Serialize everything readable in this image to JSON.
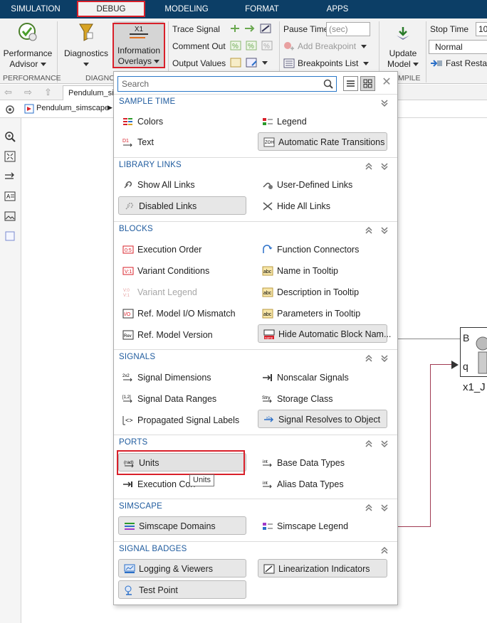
{
  "tabs": [
    {
      "label": "SIMULATION",
      "active": false
    },
    {
      "label": "DEBUG",
      "active": true
    },
    {
      "label": "MODELING",
      "active": false
    },
    {
      "label": "FORMAT",
      "active": false
    },
    {
      "label": "APPS",
      "active": false
    }
  ],
  "toolstrip": {
    "performance_advisor": "Performance Advisor",
    "perf_line1": "Performance",
    "perf_line2": "Advisor",
    "diagnostics": "Diagnostics",
    "info_line1": "Information",
    "info_line2": "Overlays",
    "info_icon_text": "X1",
    "trace_signal": "Trace Signal",
    "comment_out": "Comment Out",
    "output_values": "Output Values",
    "pause_time": "Pause Time",
    "pause_placeholder": "(sec)",
    "add_breakpoint": "Add Breakpoint",
    "breakpoints_list": "Breakpoints List",
    "update_line1": "Update",
    "update_line2": "Model",
    "stop_time": "Stop Time",
    "stop_value": "10",
    "sim_mode": "Normal",
    "fast_restart": "Fast Restart",
    "sec_performance": "PERFORMANCE",
    "sec_diagnostics": "DIAGNO",
    "sec_compile": "MPILE"
  },
  "browser": {
    "doc_tab": "Pendulum_simscape",
    "crumb": "Pendulum_simscape"
  },
  "canvas": {
    "port_b": "B",
    "port_q": "q",
    "block_label": "x1_J"
  },
  "dropdown": {
    "search_placeholder": "Search",
    "sections": {
      "sample_time": {
        "title": "SAMPLE TIME",
        "colors": "Colors",
        "legend": "Legend",
        "text": "Text",
        "auto_rate": "Automatic Rate Transitions"
      },
      "library_links": {
        "title": "LIBRARY LINKS",
        "show_all": "Show All Links",
        "user_defined": "User-Defined Links",
        "disabled": "Disabled Links",
        "hide_all": "Hide All Links"
      },
      "blocks": {
        "title": "BLOCKS",
        "execution_order": "Execution Order",
        "function_connectors": "Function Connectors",
        "variant_conditions": "Variant Conditions",
        "name_tooltip": "Name in Tooltip",
        "variant_legend": "Variant Legend",
        "desc_tooltip": "Description in Tooltip",
        "ref_io": "Ref. Model I/O Mismatch",
        "params_tooltip": "Parameters in Tooltip",
        "ref_version": "Ref. Model Version",
        "hide_auto_names": "Hide Automatic Block Nam..."
      },
      "signals": {
        "title": "SIGNALS",
        "dimensions": "Signal Dimensions",
        "nonscalar": "Nonscalar Signals",
        "ranges": "Signal Data Ranges",
        "storage": "Storage Class",
        "propagated": "Propagated Signal Labels",
        "resolves": "Signal Resolves to Object"
      },
      "ports": {
        "title": "PORTS",
        "units": "Units",
        "base_types": "Base Data Types",
        "execution_context": "Execution Con",
        "alias_types": "Alias Data Types"
      },
      "simscape": {
        "title": "SIMSCAPE",
        "domains": "Simscape Domains",
        "legend": "Simscape Legend"
      },
      "signal_badges": {
        "title": "SIGNAL BADGES",
        "logging": "Logging & Viewers",
        "linearization": "Linearization Indicators",
        "test_point": "Test Point"
      }
    },
    "tooltip": "Units"
  }
}
